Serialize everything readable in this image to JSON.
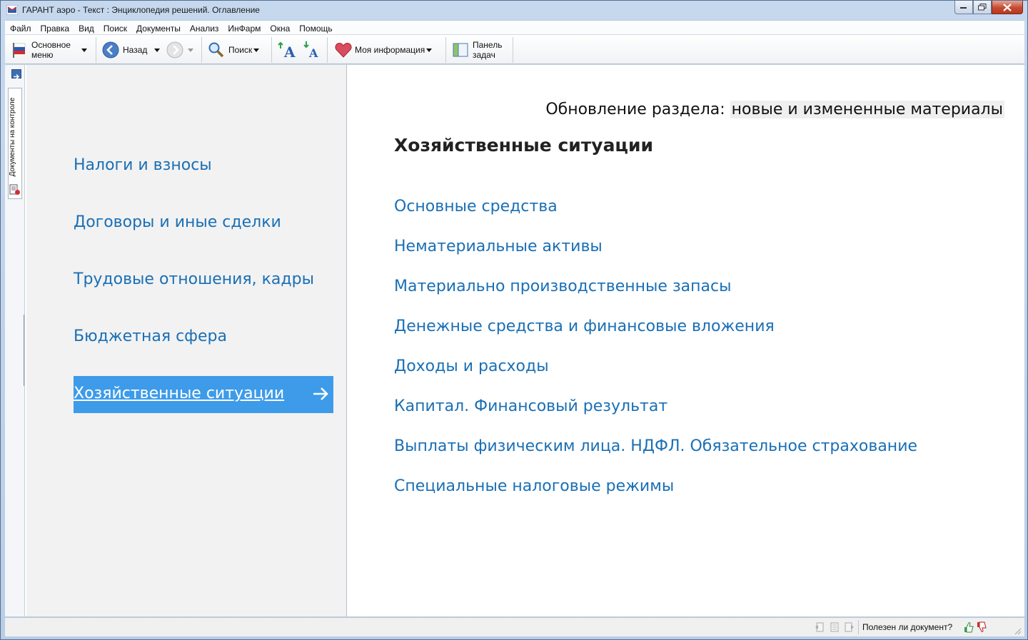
{
  "window": {
    "title": "ГАРАНТ аэро - Текст : Энциклопедия решений. Оглавление"
  },
  "menu": [
    "Файл",
    "Правка",
    "Вид",
    "Поиск",
    "Документы",
    "Анализ",
    "ИнФарм",
    "Окна",
    "Помощь"
  ],
  "toolbar": {
    "main_menu_line1": "Основное",
    "main_menu_line2": "меню",
    "back": "Назад",
    "search": "Поиск",
    "my_info": "Моя информация",
    "task_panel_line1": "Панель",
    "task_panel_line2": "задач"
  },
  "side_tab": {
    "label": "Документы на контроле"
  },
  "left_nav": {
    "items": [
      "Налоги и взносы",
      "Договоры и иные сделки",
      "Трудовые отношения, кадры",
      "Бюджетная сфера",
      "Хозяйственные ситуации"
    ],
    "active_index": 4
  },
  "main": {
    "update_prefix": "Обновление раздела:",
    "update_link": "новые и измененные материалы",
    "section_title": "Хозяйственные ситуации",
    "topics": [
      "Основные средства",
      "Нематериальные активы",
      "Материально производственные запасы",
      "Денежные средства и финансовые вложения",
      "Доходы и расходы",
      "Капитал. Финансовый результат",
      "Выплаты физическим лица. НДФЛ. Обязательное страхование",
      "Специальные налоговые режимы"
    ]
  },
  "status": {
    "useful_question": "Полезен ли документ?"
  },
  "colors": {
    "link": "#1a6fb5",
    "active_bg": "#3d9be9"
  }
}
